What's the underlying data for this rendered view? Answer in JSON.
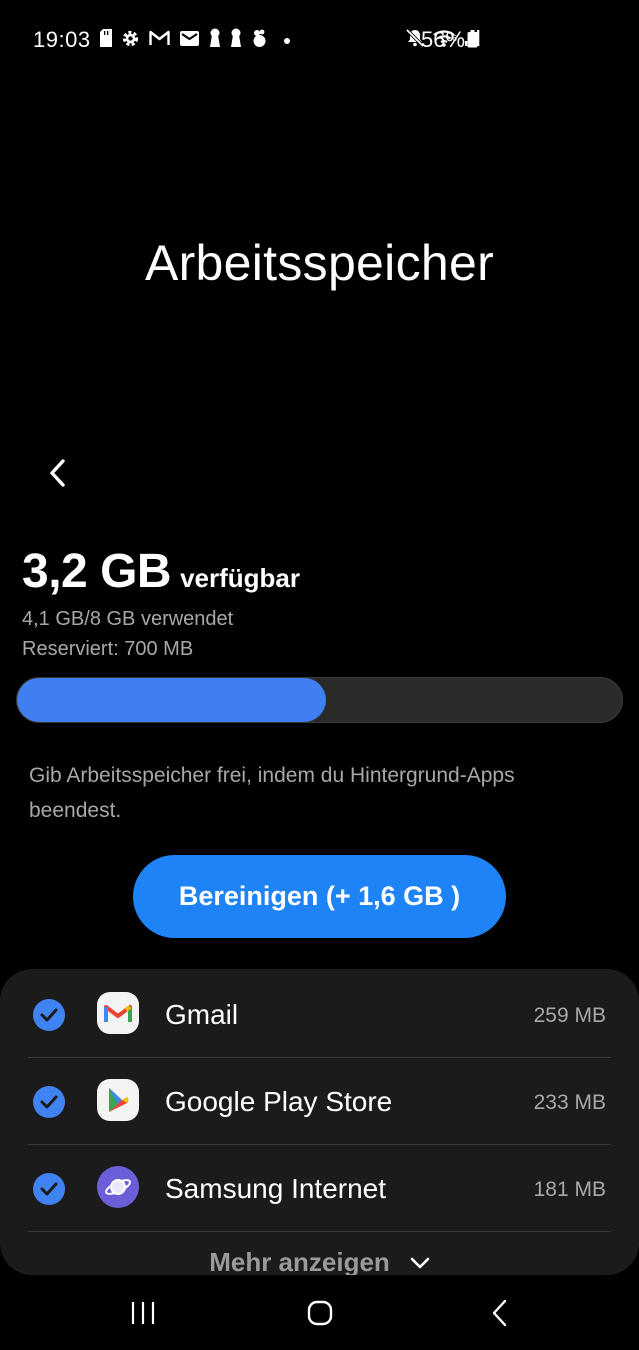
{
  "status_bar": {
    "time": "19:03",
    "battery": "56%",
    "left_icons": [
      "sd-card-icon",
      "settings-icon",
      "gmail-icon",
      "mail-icon",
      "keyhole-icon",
      "keyhole-icon",
      "app-notification-icon",
      "dot-icon"
    ],
    "right_icons": [
      "mute-icon",
      "wifi-icon",
      "signal-icon",
      "battery-icon"
    ]
  },
  "header": {
    "title": "Arbeitsspeicher"
  },
  "memory": {
    "available_value": "3,2 GB",
    "available_label": "verfügbar",
    "used_text": "4,1 GB/8 GB verwendet",
    "reserved_text": "Reserviert: 700 MB",
    "usage_fraction": 0.51,
    "hint": "Gib Arbeitsspeicher frei, indem du Hintergrund-Apps beendest."
  },
  "clean_button": {
    "label": "Bereinigen (+ 1,6 GB )"
  },
  "apps": [
    {
      "name": "Gmail",
      "size": "259 MB",
      "checked": true,
      "icon": "gmail-icon"
    },
    {
      "name": "Google Play Store",
      "size": "233 MB",
      "checked": true,
      "icon": "play-store-icon"
    },
    {
      "name": "Samsung Internet",
      "size": "181 MB",
      "checked": true,
      "icon": "samsung-internet-icon"
    }
  ],
  "more": {
    "label": "Mehr anzeigen"
  },
  "colors": {
    "accent": "#1d83f7",
    "progress": "#3f7ff0",
    "check": "#3f84f2",
    "panel": "#1b1b1b",
    "background": "#000000"
  }
}
